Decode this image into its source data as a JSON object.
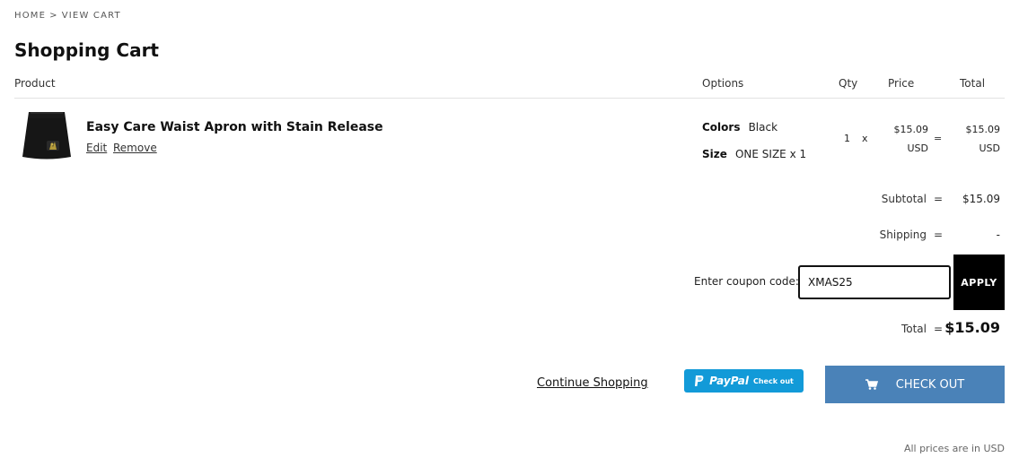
{
  "breadcrumb": {
    "home": "HOME",
    "separator": ">",
    "current": "VIEW CART"
  },
  "page_title": "Shopping Cart",
  "columns": {
    "product": "Product",
    "options": "Options",
    "qty": "Qty",
    "price": "Price",
    "total": "Total"
  },
  "items": [
    {
      "thumbnail_icon": "apron-image",
      "name": "Easy Care Waist Apron with Stain Release",
      "edit_label": "Edit",
      "remove_label": "Remove",
      "options": [
        {
          "label": "Colors",
          "value": "Black"
        },
        {
          "label": "Size",
          "value": "ONE SIZE x 1"
        }
      ],
      "qty": "1",
      "times": "x",
      "price_amount": "$15.09",
      "price_currency": "USD",
      "equals": "=",
      "total_amount": "$15.09",
      "total_currency": "USD"
    }
  ],
  "summary": {
    "subtotal_label": "Subtotal",
    "subtotal_value": "$15.09",
    "shipping_label": "Shipping",
    "shipping_value": "-",
    "equals": "="
  },
  "coupon": {
    "label": "Enter coupon code:",
    "value": "XMAS25",
    "apply_label": "APPLY"
  },
  "total": {
    "label": "Total",
    "equals": "=",
    "value": "$15.09"
  },
  "actions": {
    "continue_label": "Continue Shopping",
    "paypal_word": "PayPal",
    "paypal_sub": "Check out",
    "checkout_label": "CHECK OUT",
    "checkout_icon": "cart-icon"
  },
  "footnote": "All prices are in USD",
  "colors": {
    "checkout_blue": "#4a82b8",
    "paypal_blue": "#129ad8",
    "apply_black": "#000000"
  }
}
